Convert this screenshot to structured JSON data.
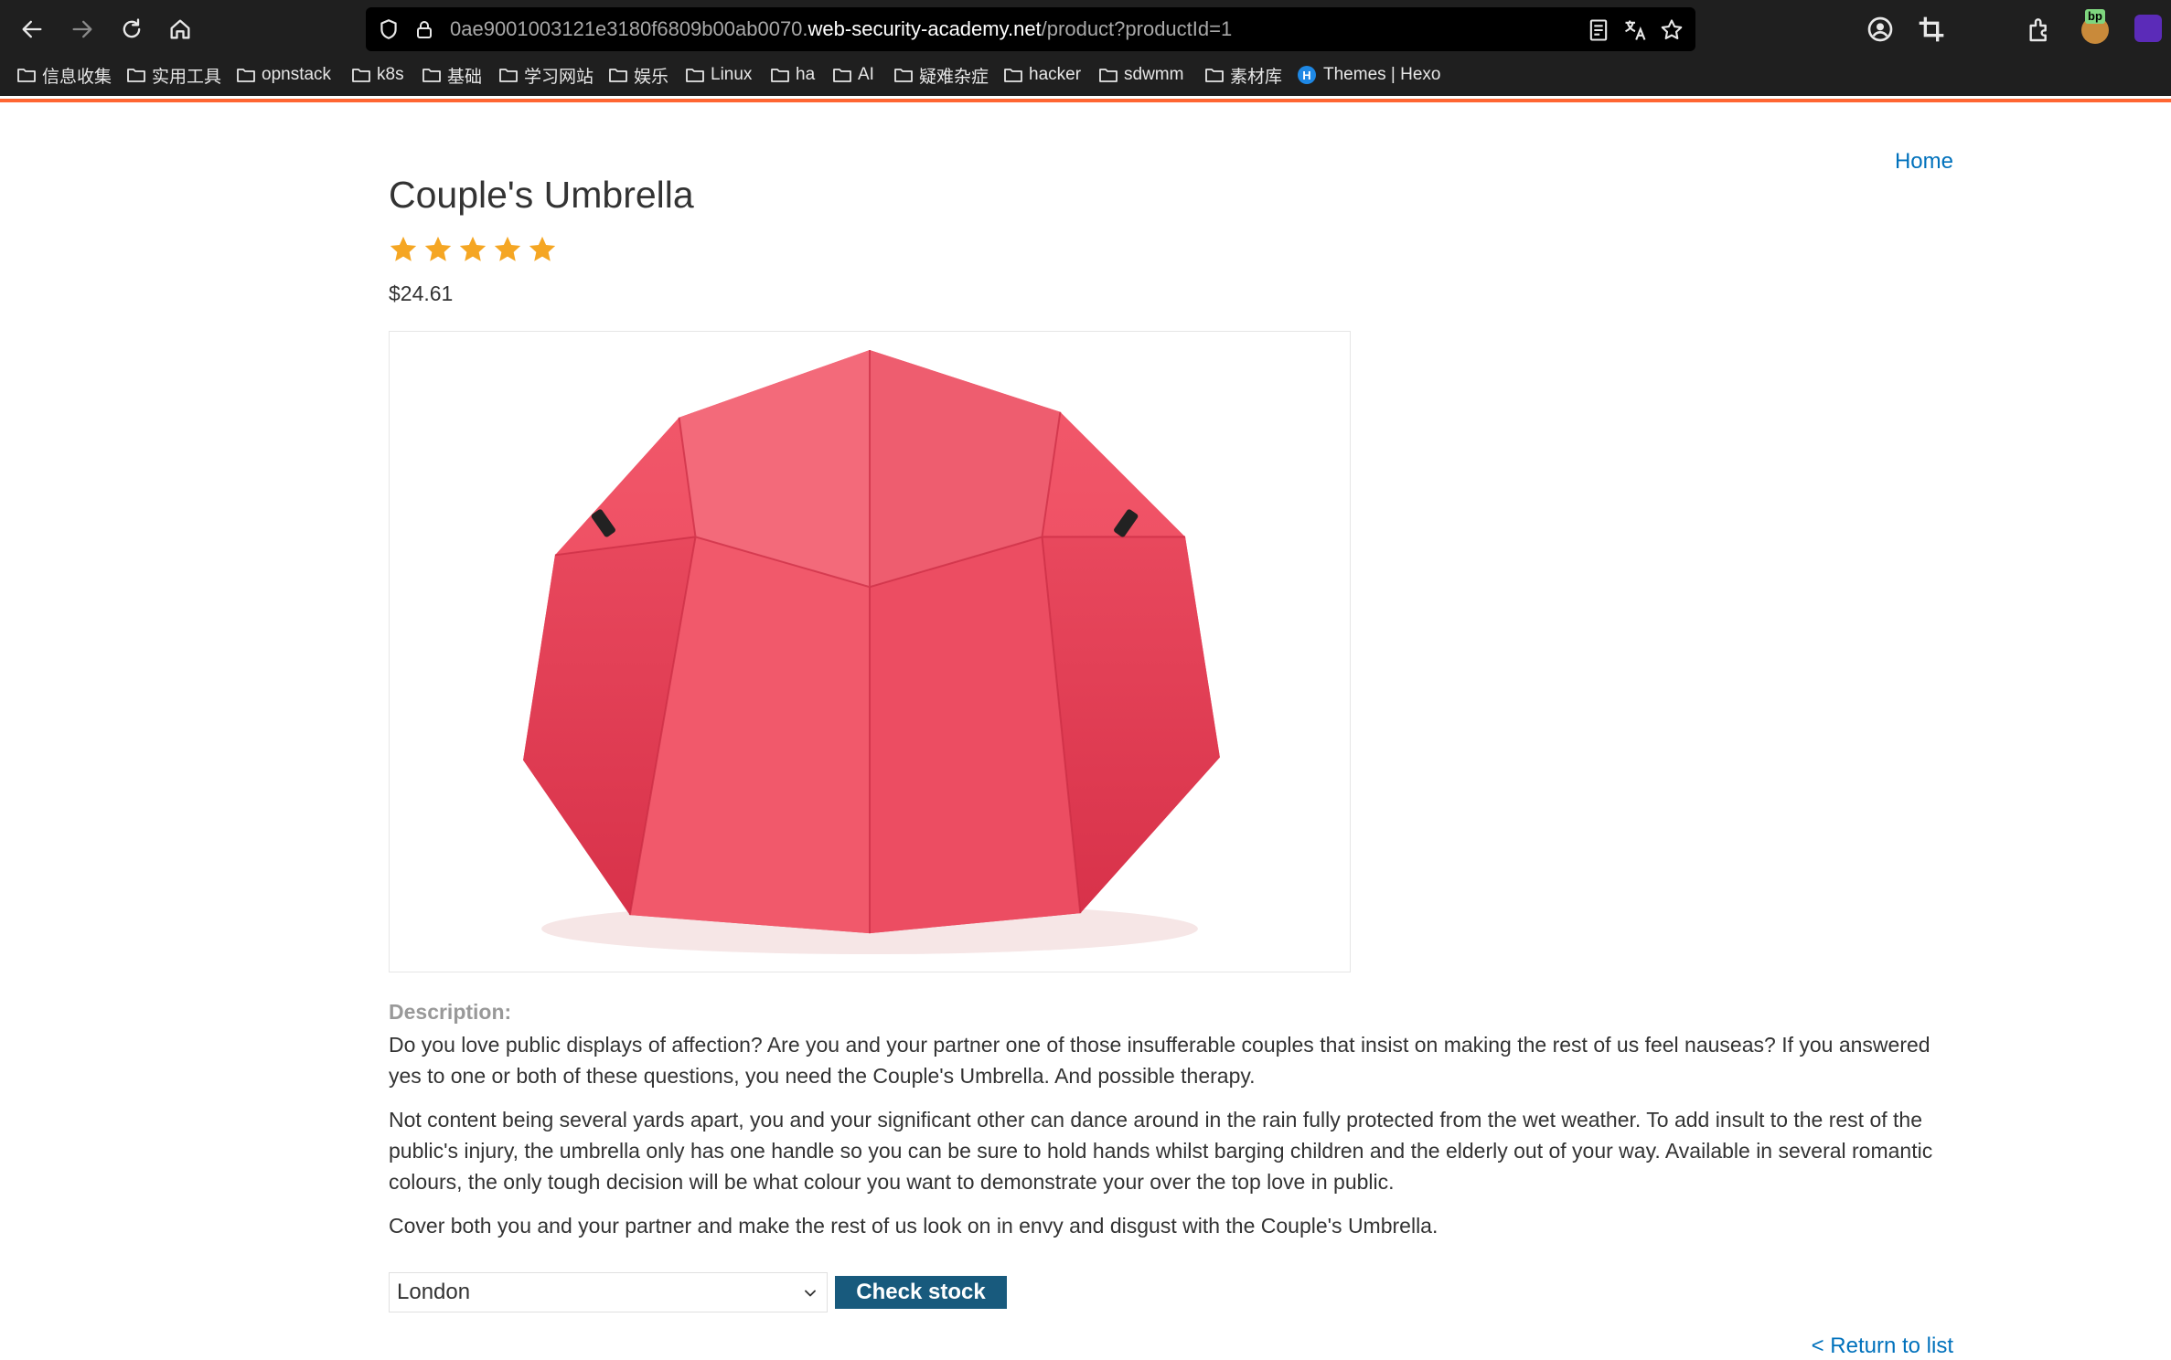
{
  "browser": {
    "url_prefix": "0ae9001003121e3180f6809b00ab0070.",
    "url_host": "web-security-academy.net",
    "url_path": "/product?productId=1",
    "extension_badge": "bp",
    "icons": [
      "back-icon",
      "forward-icon",
      "reload-icon",
      "home-icon",
      "shield-icon",
      "lock-icon",
      "reader-icon",
      "translate-icon",
      "bookmark-star-icon",
      "account-icon",
      "crop-icon",
      "extensions-icon",
      "burp-extension-icon",
      "notification-extension-icon"
    ],
    "bookmarks": [
      {
        "label": "信息收集",
        "icon": "folder-icon"
      },
      {
        "label": "实用工具",
        "icon": "folder-icon"
      },
      {
        "label": "opnstack",
        "icon": "folder-icon"
      },
      {
        "label": "k8s",
        "icon": "folder-icon"
      },
      {
        "label": "基础",
        "icon": "folder-icon"
      },
      {
        "label": "学习网站",
        "icon": "folder-icon"
      },
      {
        "label": "娱乐",
        "icon": "folder-icon"
      },
      {
        "label": "Linux",
        "icon": "folder-icon"
      },
      {
        "label": "ha",
        "icon": "folder-icon"
      },
      {
        "label": "AI",
        "icon": "folder-icon"
      },
      {
        "label": "疑难杂症",
        "icon": "folder-icon"
      },
      {
        "label": "hacker",
        "icon": "folder-icon"
      },
      {
        "label": "sdwmm",
        "icon": "folder-icon"
      },
      {
        "label": "素材库",
        "icon": "folder-icon"
      },
      {
        "label": "Themes | Hexo",
        "icon": "hexo-icon",
        "badge": "H"
      }
    ]
  },
  "header": {
    "home_link": "Home",
    "accent_color": "#ff6633"
  },
  "product": {
    "title": "Couple's Umbrella",
    "rating": 5,
    "rating_max": 5,
    "price": "$24.61",
    "image_subject": "red double umbrella",
    "description_label": "Description:",
    "description": [
      "Do you love public displays of affection? Are you and your partner one of those insufferable couples that insist on making the rest of us feel nauseas? If you answered yes to one or both of these questions, you need the Couple's Umbrella. And possible therapy.",
      "Not content being several yards apart, you and your significant other can dance around in the rain fully protected from the wet weather. To add insult to the rest of the public's injury, the umbrella only has one handle so you can be sure to hold hands whilst barging children and the elderly out of your way. Available in several romantic colours, the only tough decision will be what colour you want to demonstrate your over the top love in public.",
      "Cover both you and your partner and make the rest of us look on in envy and disgust with the Couple's Umbrella."
    ]
  },
  "stock": {
    "store_selected": "London",
    "check_button": "Check stock",
    "button_color": "#185a7d"
  },
  "footer": {
    "return_link": "< Return to list"
  },
  "colors": {
    "link": "#0071bc",
    "star": "#f5a623",
    "text": "#333333",
    "label": "#999999"
  }
}
